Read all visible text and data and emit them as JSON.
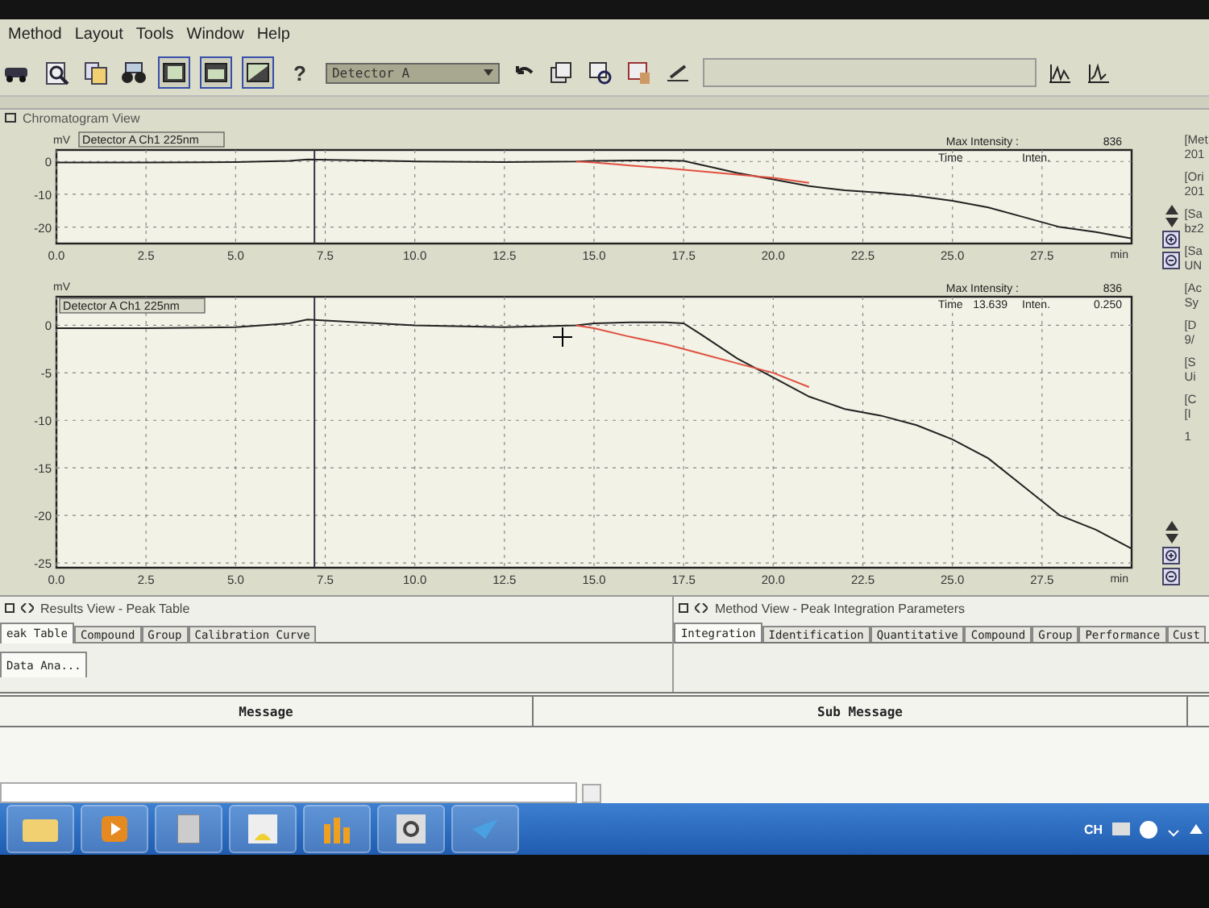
{
  "menu": [
    "Method",
    "Layout",
    "Tools",
    "Window",
    "Help"
  ],
  "toolbar": {
    "help": "?",
    "detector": "Detector A"
  },
  "chromatogram_view": {
    "title": "Chromatogram View",
    "charts": [
      {
        "max_intensity_label": "Max Intensity :",
        "max_intensity": "836",
        "time_label": "Time",
        "inten_label": "Inten.",
        "chart_data": {
          "type": "line",
          "xlabel": "min",
          "ylabel": "mV",
          "x": [
            0,
            2.5,
            5,
            6.5,
            7,
            10,
            12.5,
            14.5,
            15,
            16,
            17,
            17.5,
            18,
            19,
            20,
            21,
            22,
            23,
            24,
            25,
            26,
            27,
            28,
            29,
            30
          ],
          "series": [
            {
              "name": "Detector A Ch1 225nm",
              "color": "#222222",
              "values": [
                -0.3,
                -0.3,
                -0.2,
                0.2,
                0.6,
                0,
                -0.2,
                0,
                0.2,
                0.3,
                0.3,
                0.2,
                -1,
                -3.5,
                -5.5,
                -7.5,
                -8.8,
                -9.5,
                -10.5,
                -12,
                -14,
                -17,
                -20,
                -21.5,
                -23.5
              ]
            },
            {
              "color": "#e05040",
              "values": [
                null,
                null,
                null,
                null,
                null,
                null,
                null,
                0,
                -0.3,
                -1.2,
                -2,
                -2.5,
                -3,
                -4,
                -5,
                -6.5,
                null,
                null,
                null,
                null,
                null,
                null,
                null,
                null,
                null
              ]
            }
          ],
          "xlim": [
            0,
            30
          ],
          "ylim": [
            -25,
            3.5
          ],
          "xticks": [
            {
              "value": 0,
              "label": "0.0"
            },
            2.5,
            {
              "value": 5,
              "label": "5.0"
            },
            7.5,
            {
              "value": 10,
              "label": "10.0"
            },
            12.5,
            {
              "value": 15,
              "label": "15.0"
            },
            17.5,
            {
              "value": 20,
              "label": "20.0"
            },
            22.5,
            {
              "value": 25,
              "label": "25.0"
            },
            27.5
          ],
          "yticks": [
            0,
            -10,
            -20
          ],
          "grid": true,
          "ref_lines": [
            {
              "axis": "x",
              "value": 7.2
            }
          ]
        }
      },
      {
        "max_intensity_label": "Max Intensity :",
        "max_intensity": "836",
        "time_label": "Time",
        "time_value": "13.639",
        "inten_label": "Inten.",
        "inten_value": "0.250",
        "chart_data": {
          "type": "line",
          "xlabel": "min",
          "ylabel": "mV",
          "x": [
            0,
            2.5,
            5,
            6.5,
            7,
            10,
            12.5,
            14.5,
            15,
            16,
            17,
            17.5,
            18,
            19,
            20,
            21,
            22,
            23,
            24,
            25,
            26,
            27,
            28,
            29,
            30
          ],
          "series": [
            {
              "name": "Detector A Ch1 225nm",
              "color": "#222222",
              "values": [
                -0.3,
                -0.3,
                -0.2,
                0.2,
                0.6,
                0,
                -0.2,
                0,
                0.2,
                0.3,
                0.3,
                0.2,
                -1,
                -3.5,
                -5.5,
                -7.5,
                -8.8,
                -9.5,
                -10.5,
                -12,
                -14,
                -17,
                -20,
                -21.5,
                -23.5
              ]
            },
            {
              "color": "#e05040",
              "values": [
                null,
                null,
                null,
                null,
                null,
                null,
                null,
                0,
                -0.3,
                -1.2,
                -2,
                -2.5,
                -3,
                -4,
                -5,
                -6.5,
                null,
                null,
                null,
                null,
                null,
                null,
                null,
                null,
                null
              ]
            }
          ],
          "xlim": [
            0,
            30
          ],
          "ylim": [
            -25.5,
            3
          ],
          "xticks": [
            {
              "value": 0,
              "label": "0.0"
            },
            2.5,
            {
              "value": 5,
              "label": "5.0"
            },
            7.5,
            {
              "value": 10,
              "label": "10.0"
            },
            12.5,
            {
              "value": 15,
              "label": "15.0"
            },
            17.5,
            {
              "value": 20,
              "label": "20.0"
            },
            22.5,
            {
              "value": 25,
              "label": "25.0"
            },
            27.5
          ],
          "yticks": [
            0,
            -5,
            -10,
            -15,
            -20,
            -25
          ],
          "grid": true,
          "ref_lines": [
            {
              "axis": "x",
              "value": 7.2
            }
          ]
        }
      }
    ],
    "side_info": [
      "[Met",
      "201",
      "[Ori",
      "201",
      "[Sa",
      "bz2",
      "[Sa",
      "UN",
      "[Ac",
      "Sy",
      "[D",
      "9/",
      "[S",
      "Ui",
      "[C",
      "[I",
      "1"
    ]
  },
  "results_view": {
    "title": "Results View - Peak Table",
    "tabs": [
      {
        "label": "eak Table",
        "selected": true
      },
      {
        "label": "Compound",
        "selected": false
      },
      {
        "label": "Group",
        "selected": false
      },
      {
        "label": "Calibration Curve",
        "selected": false
      }
    ],
    "sub_tabs": [
      {
        "label": "Data Ana...",
        "selected": true
      }
    ]
  },
  "method_view": {
    "title": "Method View - Peak Integration Parameters",
    "tabs": [
      {
        "label": "Integration",
        "selected": true
      },
      {
        "label": "Identification",
        "selected": false
      },
      {
        "label": "Quantitative",
        "selected": false
      },
      {
        "label": "Compound",
        "selected": false
      },
      {
        "label": "Group",
        "selected": false
      },
      {
        "label": "Performance",
        "selected": false
      },
      {
        "label": "Cust",
        "selected": false
      }
    ]
  },
  "message_table": {
    "columns": [
      "Message",
      "Sub Message"
    ]
  },
  "taskbar": {
    "language": "CH"
  }
}
